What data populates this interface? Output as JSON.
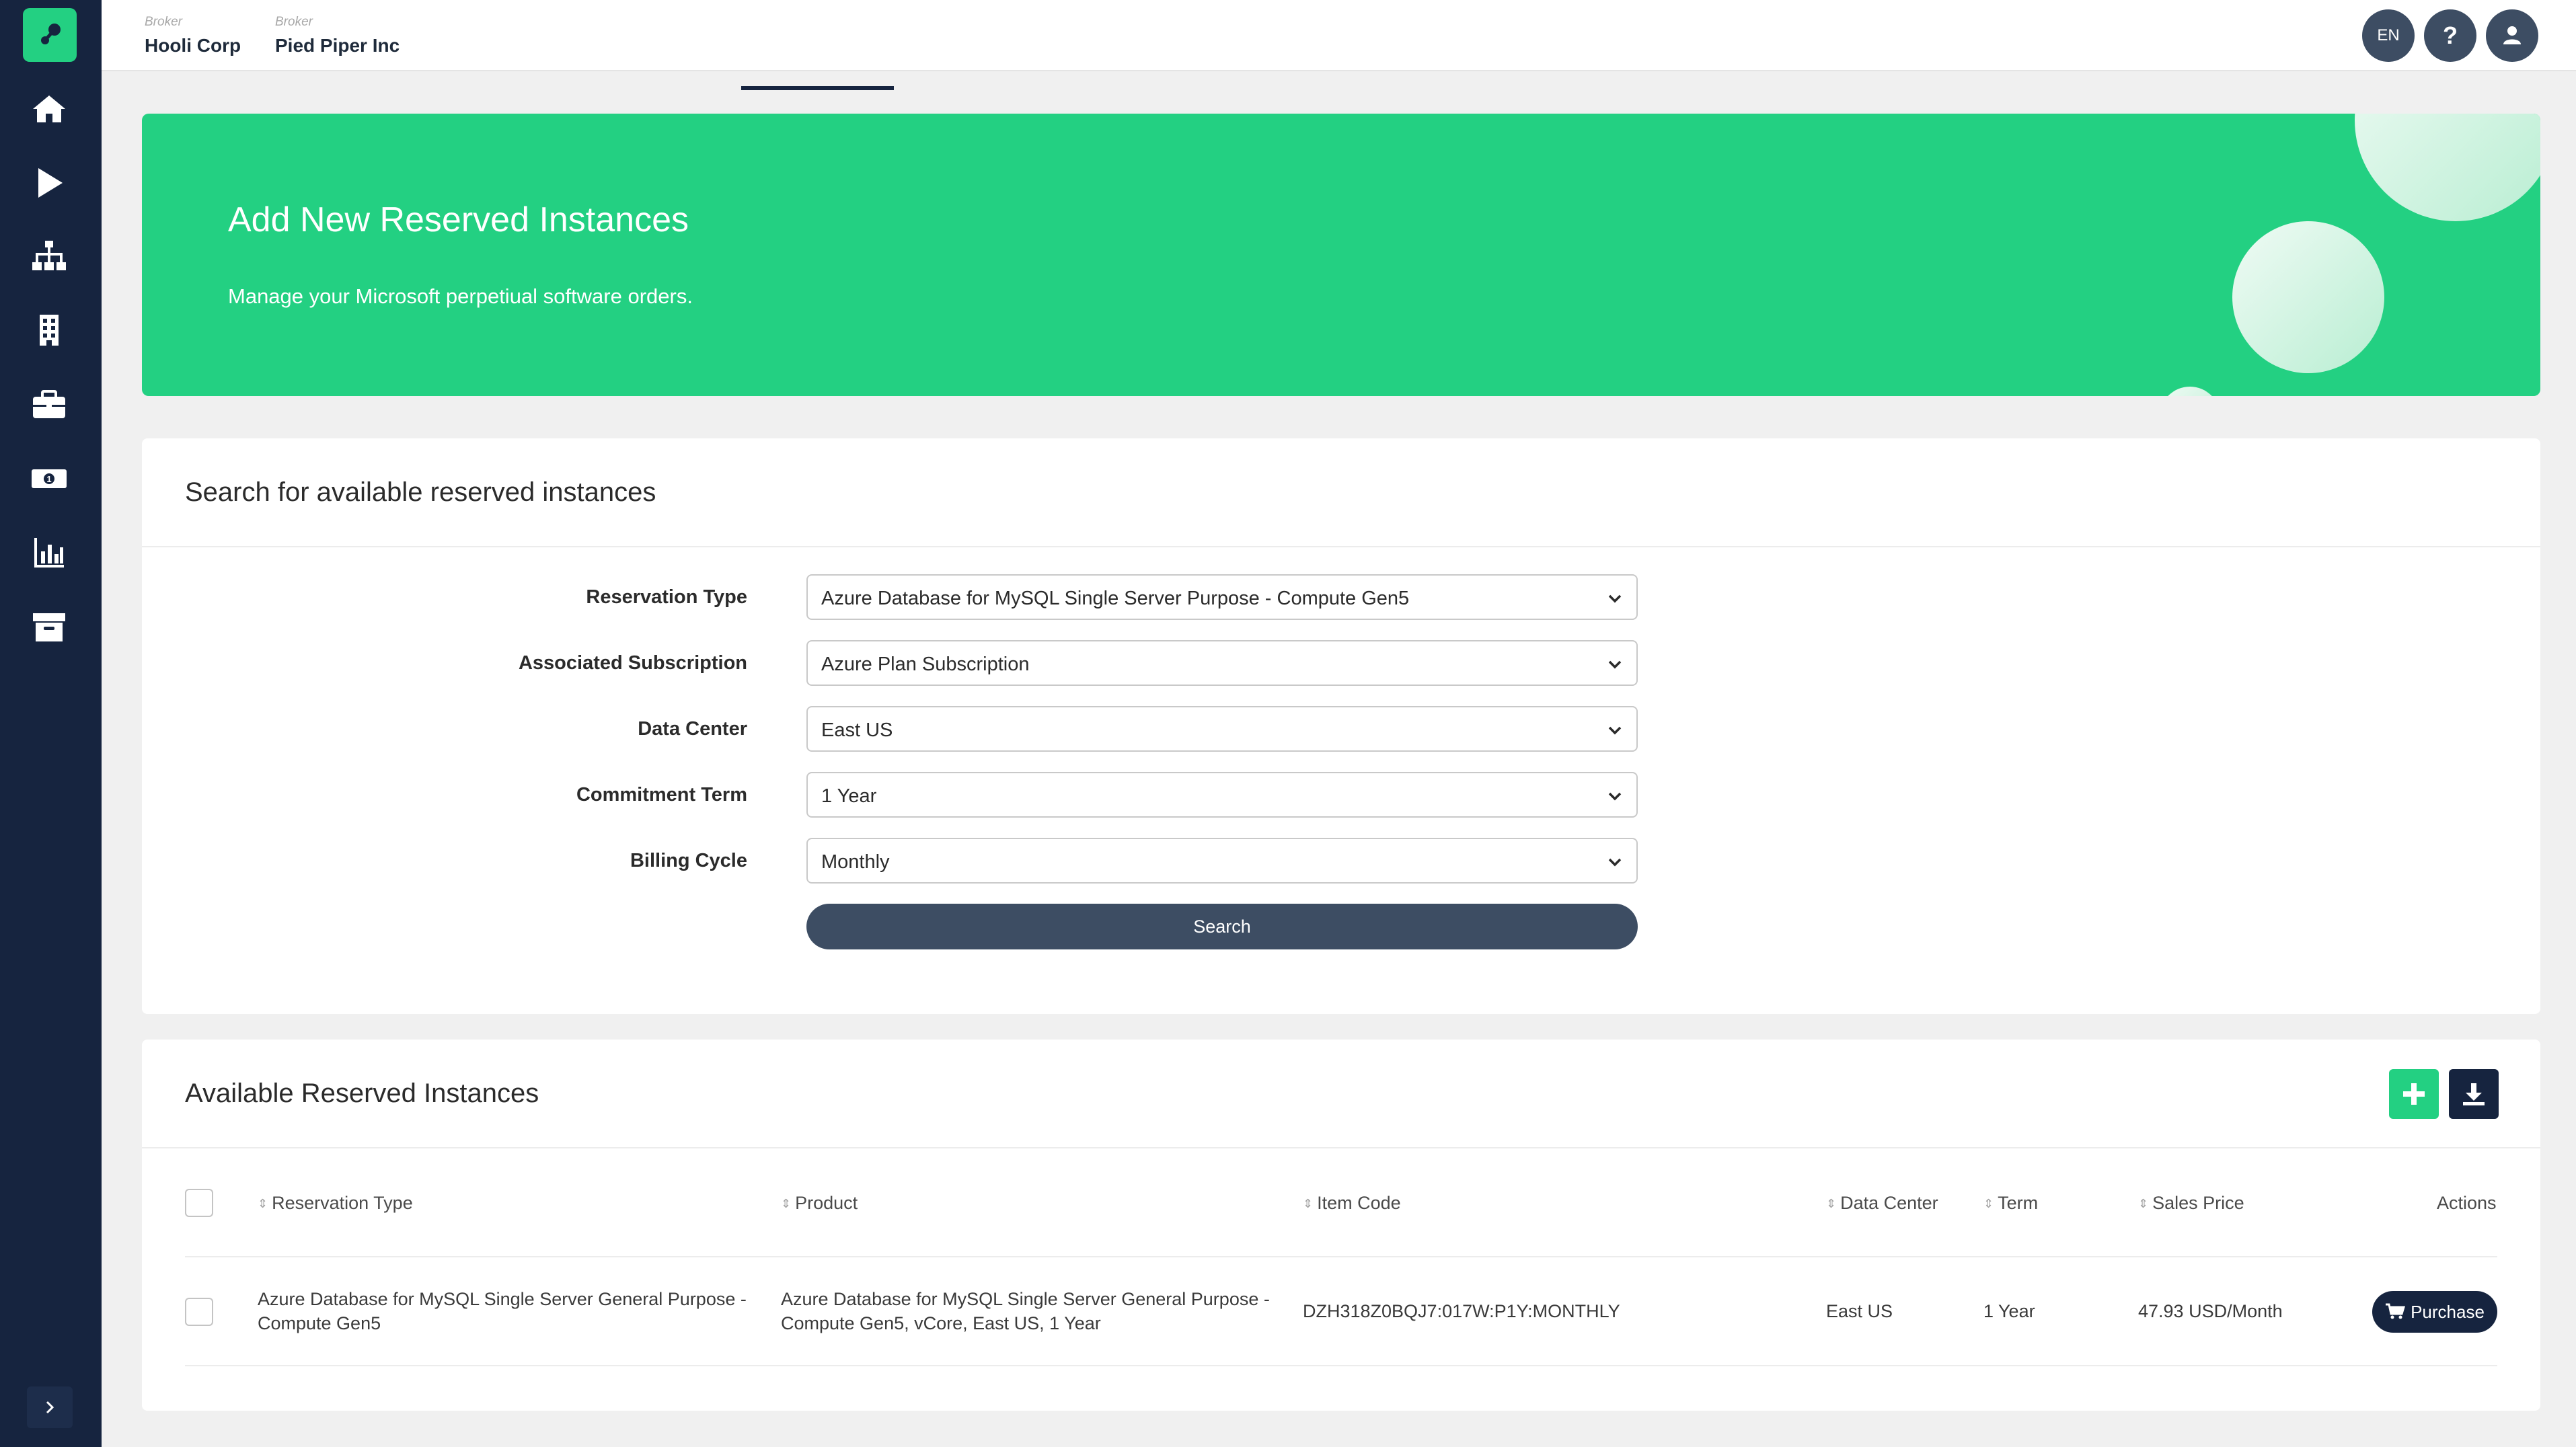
{
  "header": {
    "brokers": [
      {
        "small": "Broker",
        "name": "Hooli Corp"
      },
      {
        "small": "Broker",
        "name": "Pied Piper Inc"
      }
    ],
    "language": "EN",
    "help": "?"
  },
  "hero": {
    "title": "Add New Reserved Instances",
    "subtitle": "Manage your Microsoft perpetiual software orders."
  },
  "search_card": {
    "title": "Search for available reserved instances",
    "fields": [
      {
        "label": "Reservation Type",
        "value": "Azure Database for MySQL Single Server Purpose - Compute Gen5"
      },
      {
        "label": "Associated Subscription",
        "value": "Azure Plan Subscription"
      },
      {
        "label": "Data Center",
        "value": "East US"
      },
      {
        "label": "Commitment Term",
        "value": "1 Year"
      },
      {
        "label": "Billing Cycle",
        "value": "Monthly"
      }
    ],
    "search_label": "Search"
  },
  "results_card": {
    "title": "Available Reserved Instances",
    "columns": [
      "Reservation Type",
      "Product",
      "Item Code",
      "Data Center",
      "Term",
      "Sales Price",
      "Actions"
    ],
    "rows": [
      {
        "reservation_type_line1": "Azure Database for MySQL Single Server General Purpose -",
        "reservation_type_line2": "Compute Gen5",
        "product_line1": "Azure Database for MySQL Single Server General Purpose -",
        "product_line2": "Compute Gen5, vCore, East US, 1 Year",
        "item_code": "DZH318Z0BQJ7:017W:P1Y:MONTHLY",
        "data_center": "East US",
        "term": "1 Year",
        "sales_price": "47.93 USD/Month",
        "action_label": "Purchase"
      }
    ]
  },
  "sidebar": {
    "icons": [
      "home-icon",
      "play-icon",
      "sitemap-icon",
      "building-icon",
      "briefcase-icon",
      "money-icon",
      "chart-icon",
      "archive-icon"
    ]
  },
  "colors": {
    "sidebar": "#16243f",
    "accent": "#23d082",
    "button_dark": "#3d4d63"
  }
}
